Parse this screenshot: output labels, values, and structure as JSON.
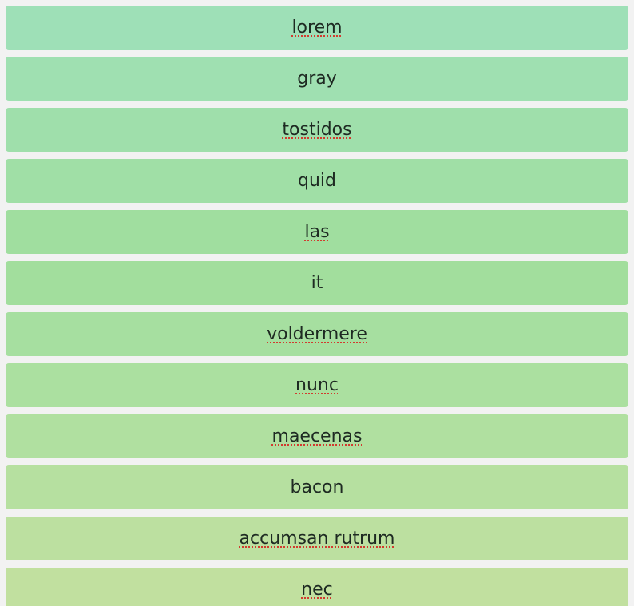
{
  "list": {
    "items": [
      {
        "label": "lorem",
        "color": "#9ee0b7",
        "spellcheck": true
      },
      {
        "label": "gray",
        "color": "#9fe0b1",
        "spellcheck": false
      },
      {
        "label": "tostidos",
        "color": "#9fdfab",
        "spellcheck": true
      },
      {
        "label": "quid",
        "color": "#a0dfa6",
        "spellcheck": false
      },
      {
        "label": "las",
        "color": "#a0de9f",
        "spellcheck": true
      },
      {
        "label": "it",
        "color": "#a2de9d",
        "spellcheck": false
      },
      {
        "label": "voldermere",
        "color": "#a6dfa0",
        "spellcheck": true
      },
      {
        "label": "nunc",
        "color": "#abe0a0",
        "spellcheck": true
      },
      {
        "label": "maecenas",
        "color": "#b0e0a0",
        "spellcheck": true
      },
      {
        "label": "bacon",
        "color": "#b6e0a0",
        "spellcheck": false
      },
      {
        "label": "accumsan rutrum",
        "color": "#bce0a0",
        "spellcheck": true
      },
      {
        "label": "nec",
        "color": "#c1e09f",
        "spellcheck": true
      }
    ]
  }
}
